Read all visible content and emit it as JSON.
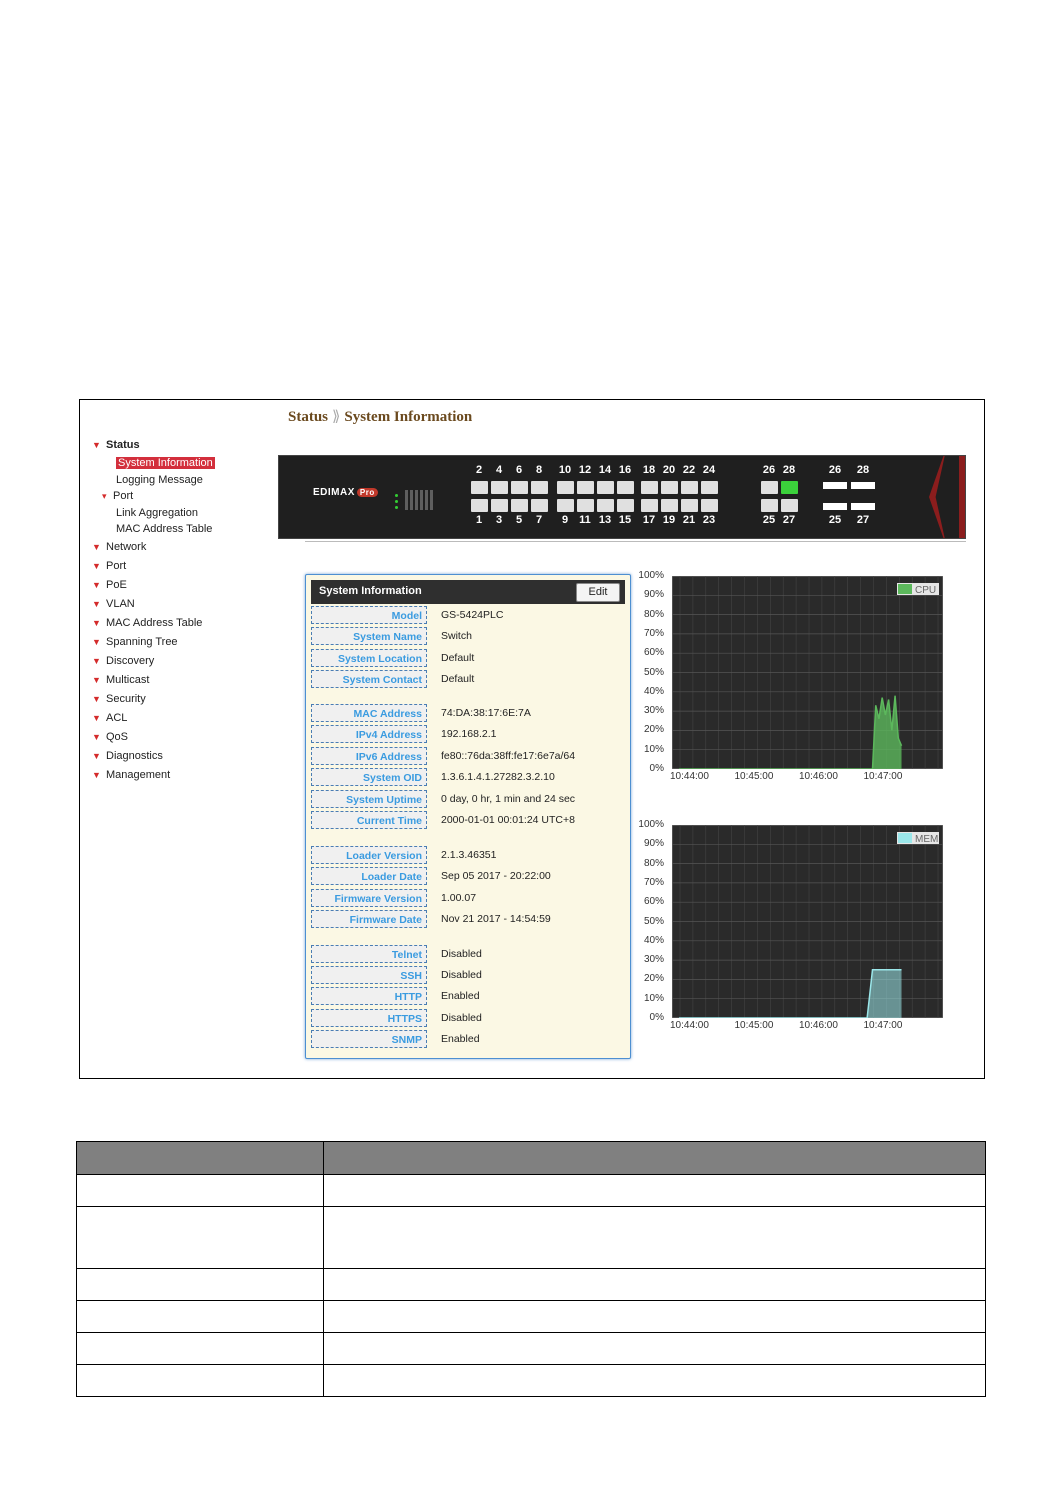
{
  "breadcrumb": {
    "section": "Status",
    "page": "System Information"
  },
  "sidebar": {
    "status": "Status",
    "status_items": [
      "System Information",
      "Logging Message"
    ],
    "port_group": "Port",
    "port_items": [
      "Link Aggregation",
      "MAC Address Table"
    ],
    "items": [
      "Network",
      "Port",
      "PoE",
      "VLAN",
      "MAC Address Table",
      "Spanning Tree",
      "Discovery",
      "Multicast",
      "Security",
      "ACL",
      "QoS",
      "Diagnostics",
      "Management"
    ]
  },
  "front_panel": {
    "brand": "EDIMAX",
    "brand_suffix": "Pro",
    "top_ports": [
      "2",
      "4",
      "6",
      "8",
      "10",
      "12",
      "14",
      "16",
      "18",
      "20",
      "22",
      "24",
      "26",
      "28"
    ],
    "bottom_ports": [
      "1",
      "3",
      "5",
      "7",
      "9",
      "11",
      "13",
      "15",
      "17",
      "19",
      "21",
      "23",
      "25",
      "27"
    ],
    "sfp_top": [
      "26",
      "28"
    ],
    "sfp_bottom": [
      "25",
      "27"
    ],
    "active_port": "28"
  },
  "card": {
    "title": "System Information",
    "edit_label": "Edit",
    "rows": [
      {
        "key": "Model",
        "value": "GS-5424PLC"
      },
      {
        "key": "System Name",
        "value": "Switch"
      },
      {
        "key": "System Location",
        "value": "Default"
      },
      {
        "key": "System Contact",
        "value": "Default"
      },
      {
        "key": "MAC Address",
        "value": "74:DA:38:17:6E:7A"
      },
      {
        "key": "IPv4 Address",
        "value": "192.168.2.1"
      },
      {
        "key": "IPv6 Address",
        "value": "fe80::76da:38ff:fe17:6e7a/64"
      },
      {
        "key": "System OID",
        "value": "1.3.6.1.4.1.27282.3.2.10"
      },
      {
        "key": "System Uptime",
        "value": "0 day, 0 hr, 1 min and 24 sec"
      },
      {
        "key": "Current Time",
        "value": "2000-01-01 00:01:24 UTC+8"
      },
      {
        "key": "Loader Version",
        "value": "2.1.3.46351"
      },
      {
        "key": "Loader Date",
        "value": "Sep 05 2017 - 20:22:00"
      },
      {
        "key": "Firmware Version",
        "value": "1.00.07"
      },
      {
        "key": "Firmware Date",
        "value": "Nov 21 2017 - 14:54:59"
      },
      {
        "key": "Telnet",
        "value": "Disabled"
      },
      {
        "key": "SSH",
        "value": "Disabled"
      },
      {
        "key": "HTTP",
        "value": "Enabled"
      },
      {
        "key": "HTTPS",
        "value": "Disabled"
      },
      {
        "key": "SNMP",
        "value": "Enabled"
      }
    ]
  },
  "chart_data": [
    {
      "type": "area",
      "legend": "CPU",
      "color": "#5cb85c",
      "y_ticks": [
        "100%",
        "90%",
        "80%",
        "70%",
        "60%",
        "50%",
        "40%",
        "30%",
        "20%",
        "10%",
        "0%"
      ],
      "x_ticks": [
        "10:44:00",
        "10:45:00",
        "10:46:00",
        "10:47:00"
      ],
      "ylim": [
        0,
        100
      ],
      "x": [
        "10:44:00",
        "10:45:00",
        "10:46:00",
        "10:46:50",
        "10:47:00",
        "10:47:03",
        "10:47:06",
        "10:47:09",
        "10:47:12",
        "10:47:15",
        "10:47:18",
        "10:47:21",
        "10:47:24",
        "10:47:27"
      ],
      "values": [
        0,
        0,
        0,
        0,
        0,
        33,
        26,
        37,
        28,
        36,
        20,
        38,
        16,
        12
      ]
    },
    {
      "type": "area",
      "legend": "MEM",
      "color": "#9be7ea",
      "y_ticks": [
        "100%",
        "90%",
        "80%",
        "70%",
        "60%",
        "50%",
        "40%",
        "30%",
        "20%",
        "10%",
        "0%"
      ],
      "x_ticks": [
        "10:44:00",
        "10:45:00",
        "10:46:00",
        "10:47:00"
      ],
      "ylim": [
        0,
        100
      ],
      "x": [
        "10:44:00",
        "10:45:00",
        "10:46:00",
        "10:46:55",
        "10:47:00",
        "10:47:27"
      ],
      "values": [
        0,
        0,
        0,
        0,
        25,
        25
      ]
    }
  ],
  "param_table": {
    "rows": 6
  }
}
